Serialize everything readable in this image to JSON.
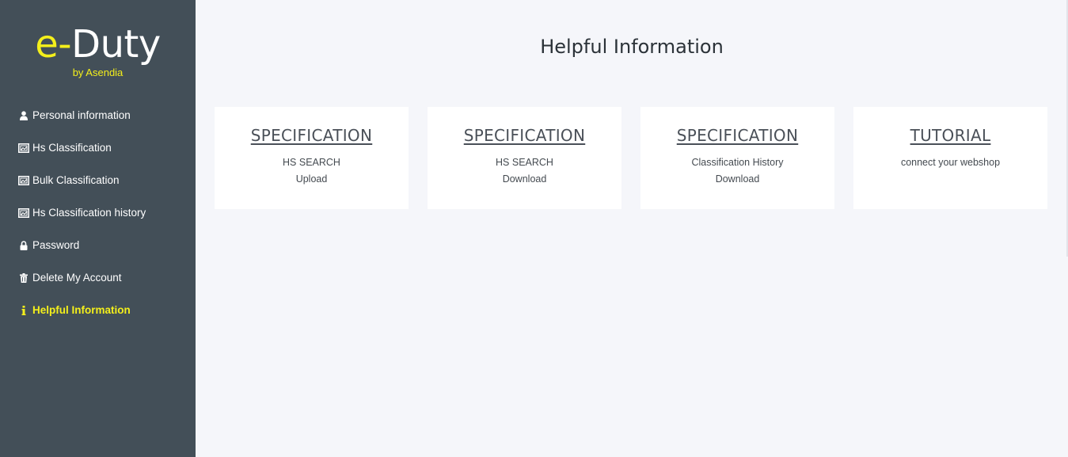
{
  "brand": {
    "prefix": "e-",
    "name": "Duty",
    "subtitle": "by Asendia",
    "accent_color": "#f4ef1b",
    "sidebar_color": "#434f58"
  },
  "sidebar": {
    "items": [
      {
        "label": "Personal information",
        "icon": "user-icon",
        "active": false
      },
      {
        "label": "Hs Classification",
        "icon": "image-frame-icon",
        "active": false
      },
      {
        "label": "Bulk Classification",
        "icon": "image-frame-icon",
        "active": false
      },
      {
        "label": "Hs Classification history",
        "icon": "image-frame-icon",
        "active": false
      },
      {
        "label": "Password",
        "icon": "lock-icon",
        "active": false
      },
      {
        "label": "Delete My Account",
        "icon": "trash-icon",
        "active": false
      },
      {
        "label": "Helpful Information",
        "icon": "info-icon",
        "active": true
      }
    ]
  },
  "main": {
    "title": "Helpful Information",
    "cards": [
      {
        "title": "SPECIFICATION",
        "line1": "HS SEARCH",
        "line2": "Upload"
      },
      {
        "title": "SPECIFICATION",
        "line1": "HS SEARCH",
        "line2": "Download"
      },
      {
        "title": "SPECIFICATION",
        "line1": "Classification History",
        "line2": "Download"
      },
      {
        "title": "TUTORIAL",
        "line1": "connect your webshop",
        "line2": ""
      }
    ]
  }
}
